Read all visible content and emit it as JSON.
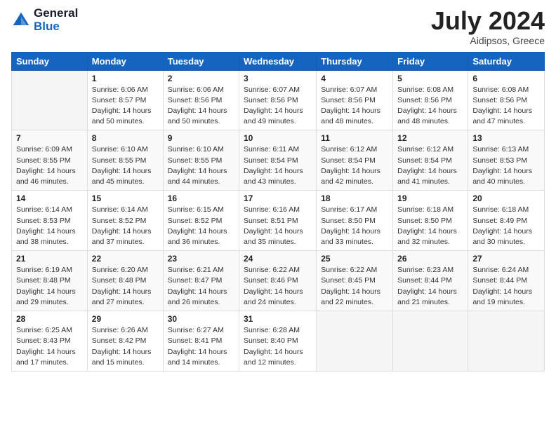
{
  "logo": {
    "general": "General",
    "blue": "Blue"
  },
  "header": {
    "month": "July 2024",
    "location": "Aidipsos, Greece"
  },
  "weekdays": [
    "Sunday",
    "Monday",
    "Tuesday",
    "Wednesday",
    "Thursday",
    "Friday",
    "Saturday"
  ],
  "weeks": [
    [
      {
        "day": null
      },
      {
        "day": "1",
        "sunrise": "6:06 AM",
        "sunset": "8:57 PM",
        "daylight": "14 hours and 50 minutes."
      },
      {
        "day": "2",
        "sunrise": "6:06 AM",
        "sunset": "8:56 PM",
        "daylight": "14 hours and 50 minutes."
      },
      {
        "day": "3",
        "sunrise": "6:07 AM",
        "sunset": "8:56 PM",
        "daylight": "14 hours and 49 minutes."
      },
      {
        "day": "4",
        "sunrise": "6:07 AM",
        "sunset": "8:56 PM",
        "daylight": "14 hours and 48 minutes."
      },
      {
        "day": "5",
        "sunrise": "6:08 AM",
        "sunset": "8:56 PM",
        "daylight": "14 hours and 48 minutes."
      },
      {
        "day": "6",
        "sunrise": "6:08 AM",
        "sunset": "8:56 PM",
        "daylight": "14 hours and 47 minutes."
      }
    ],
    [
      {
        "day": "7",
        "sunrise": "6:09 AM",
        "sunset": "8:55 PM",
        "daylight": "14 hours and 46 minutes."
      },
      {
        "day": "8",
        "sunrise": "6:10 AM",
        "sunset": "8:55 PM",
        "daylight": "14 hours and 45 minutes."
      },
      {
        "day": "9",
        "sunrise": "6:10 AM",
        "sunset": "8:55 PM",
        "daylight": "14 hours and 44 minutes."
      },
      {
        "day": "10",
        "sunrise": "6:11 AM",
        "sunset": "8:54 PM",
        "daylight": "14 hours and 43 minutes."
      },
      {
        "day": "11",
        "sunrise": "6:12 AM",
        "sunset": "8:54 PM",
        "daylight": "14 hours and 42 minutes."
      },
      {
        "day": "12",
        "sunrise": "6:12 AM",
        "sunset": "8:54 PM",
        "daylight": "14 hours and 41 minutes."
      },
      {
        "day": "13",
        "sunrise": "6:13 AM",
        "sunset": "8:53 PM",
        "daylight": "14 hours and 40 minutes."
      }
    ],
    [
      {
        "day": "14",
        "sunrise": "6:14 AM",
        "sunset": "8:53 PM",
        "daylight": "14 hours and 38 minutes."
      },
      {
        "day": "15",
        "sunrise": "6:14 AM",
        "sunset": "8:52 PM",
        "daylight": "14 hours and 37 minutes."
      },
      {
        "day": "16",
        "sunrise": "6:15 AM",
        "sunset": "8:52 PM",
        "daylight": "14 hours and 36 minutes."
      },
      {
        "day": "17",
        "sunrise": "6:16 AM",
        "sunset": "8:51 PM",
        "daylight": "14 hours and 35 minutes."
      },
      {
        "day": "18",
        "sunrise": "6:17 AM",
        "sunset": "8:50 PM",
        "daylight": "14 hours and 33 minutes."
      },
      {
        "day": "19",
        "sunrise": "6:18 AM",
        "sunset": "8:50 PM",
        "daylight": "14 hours and 32 minutes."
      },
      {
        "day": "20",
        "sunrise": "6:18 AM",
        "sunset": "8:49 PM",
        "daylight": "14 hours and 30 minutes."
      }
    ],
    [
      {
        "day": "21",
        "sunrise": "6:19 AM",
        "sunset": "8:48 PM",
        "daylight": "14 hours and 29 minutes."
      },
      {
        "day": "22",
        "sunrise": "6:20 AM",
        "sunset": "8:48 PM",
        "daylight": "14 hours and 27 minutes."
      },
      {
        "day": "23",
        "sunrise": "6:21 AM",
        "sunset": "8:47 PM",
        "daylight": "14 hours and 26 minutes."
      },
      {
        "day": "24",
        "sunrise": "6:22 AM",
        "sunset": "8:46 PM",
        "daylight": "14 hours and 24 minutes."
      },
      {
        "day": "25",
        "sunrise": "6:22 AM",
        "sunset": "8:45 PM",
        "daylight": "14 hours and 22 minutes."
      },
      {
        "day": "26",
        "sunrise": "6:23 AM",
        "sunset": "8:44 PM",
        "daylight": "14 hours and 21 minutes."
      },
      {
        "day": "27",
        "sunrise": "6:24 AM",
        "sunset": "8:44 PM",
        "daylight": "14 hours and 19 minutes."
      }
    ],
    [
      {
        "day": "28",
        "sunrise": "6:25 AM",
        "sunset": "8:43 PM",
        "daylight": "14 hours and 17 minutes."
      },
      {
        "day": "29",
        "sunrise": "6:26 AM",
        "sunset": "8:42 PM",
        "daylight": "14 hours and 15 minutes."
      },
      {
        "day": "30",
        "sunrise": "6:27 AM",
        "sunset": "8:41 PM",
        "daylight": "14 hours and 14 minutes."
      },
      {
        "day": "31",
        "sunrise": "6:28 AM",
        "sunset": "8:40 PM",
        "daylight": "14 hours and 12 minutes."
      },
      {
        "day": null
      },
      {
        "day": null
      },
      {
        "day": null
      }
    ]
  ]
}
